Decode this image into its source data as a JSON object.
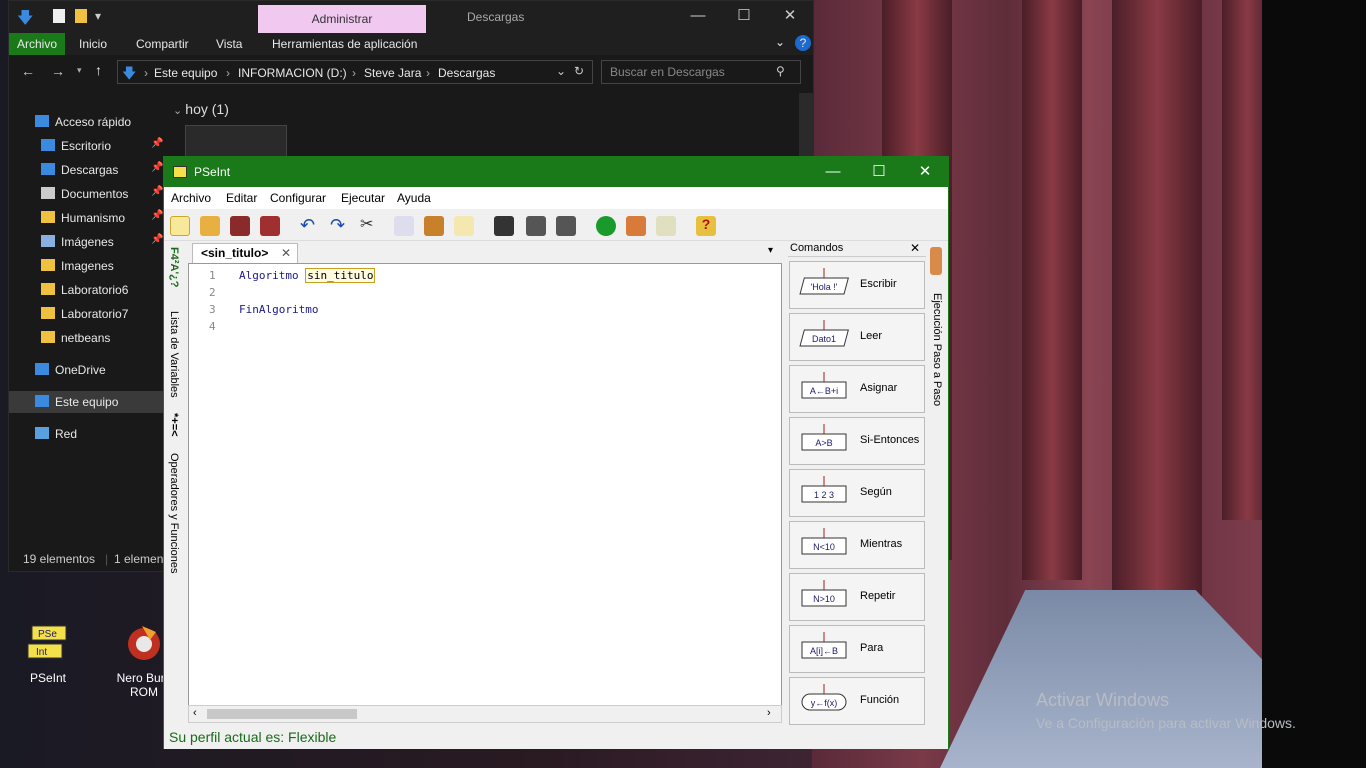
{
  "explorer": {
    "tabs": {
      "admin": "Administrar",
      "descargas": "Descargas"
    },
    "ribbon": {
      "archivo": "Archivo",
      "inicio": "Inicio",
      "compartir": "Compartir",
      "vista": "Vista",
      "herramientas": "Herramientas de aplicación"
    },
    "breadcrumb": [
      "Este equipo",
      "INFORMACION (D:)",
      "Steve Jara",
      "Descargas"
    ],
    "search_placeholder": "Buscar en Descargas",
    "group_header": "hoy (1)",
    "sidebar": [
      {
        "label": "Acceso rápido",
        "icon": "star-icon"
      },
      {
        "label": "Escritorio",
        "icon": "desktop-icon",
        "pinned": true
      },
      {
        "label": "Descargas",
        "icon": "download-icon",
        "pinned": true
      },
      {
        "label": "Documentos",
        "icon": "document-icon",
        "pinned": true
      },
      {
        "label": "Humanismo",
        "icon": "folder-icon",
        "pinned": true
      },
      {
        "label": "Imágenes",
        "icon": "image-icon",
        "pinned": true
      },
      {
        "label": "Imagenes",
        "icon": "folder-icon"
      },
      {
        "label": "Laboratorio6",
        "icon": "folder-icon"
      },
      {
        "label": "Laboratorio7",
        "icon": "folder-icon"
      },
      {
        "label": "netbeans",
        "icon": "folder-icon"
      },
      {
        "label": "OneDrive",
        "icon": "cloud-icon"
      },
      {
        "label": "Este equipo",
        "icon": "computer-icon"
      },
      {
        "label": "Red",
        "icon": "network-icon"
      }
    ],
    "status": {
      "count": "19 elementos",
      "selected": "1 elemen"
    }
  },
  "desktop": {
    "icons": [
      {
        "label": "PSeInt"
      },
      {
        "label": "Nero Burn ROM"
      }
    ],
    "watermark": {
      "line1": "Activar Windows",
      "line2": "Ve a Configuración para activar Windows."
    }
  },
  "pseint": {
    "title": "PSeInt",
    "menu": [
      "Archivo",
      "Editar",
      "Configurar",
      "Ejecutar",
      "Ayuda"
    ],
    "tab": "<sin_titulo>",
    "left_tabs": {
      "variables": "Lista de Variables",
      "operadores": "Operadores y Funciones",
      "var_icon": "F4²A'¿?",
      "op_icon": "*+=<"
    },
    "code": [
      {
        "n": "1",
        "kw": "Algoritmo",
        "rest": "sin_titulo"
      },
      {
        "n": "2",
        "kw": "",
        "rest": ""
      },
      {
        "n": "3",
        "kw": "FinAlgoritmo",
        "rest": ""
      },
      {
        "n": "4",
        "kw": "",
        "rest": ""
      }
    ],
    "commands": {
      "header": "Comandos",
      "items": [
        {
          "label": "Escribir",
          "glyph": "'Hola !'"
        },
        {
          "label": "Leer",
          "glyph": "Dato1"
        },
        {
          "label": "Asignar",
          "glyph": "A←B+i"
        },
        {
          "label": "Si-Entonces",
          "glyph": "A>B"
        },
        {
          "label": "Según",
          "glyph": "1 2 3"
        },
        {
          "label": "Mientras",
          "glyph": "N<10"
        },
        {
          "label": "Repetir",
          "glyph": "N>10"
        },
        {
          "label": "Para",
          "glyph": "A[i]←B"
        },
        {
          "label": "Función",
          "glyph": "y←f(x)"
        }
      ]
    },
    "right_tab": "Ejecución Paso a Paso",
    "status": "Su perfil actual es: Flexible",
    "colors": {
      "titlebar": "#1a7a1a",
      "keyword": "#1a1a8a",
      "status_text": "#1a6a1a"
    }
  }
}
